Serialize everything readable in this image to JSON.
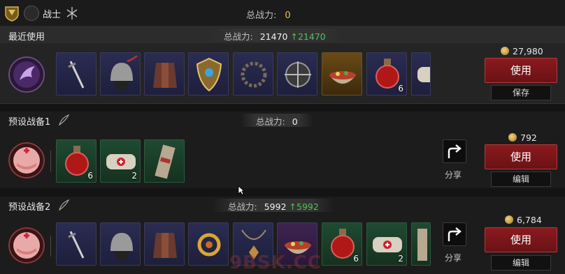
{
  "topbar": {
    "class_name": "战士",
    "power_label": "总战力:",
    "power_value": "0",
    "icons": [
      "rank-badge-icon",
      "class-crest-icon"
    ]
  },
  "recent": {
    "title": "最近使用",
    "power_label": "总战力:",
    "power_value": "21470",
    "power_gain": "↑21470",
    "price": "27,980",
    "use_label": "使用",
    "save_label": "保存",
    "items": [
      {
        "icon": "sword-icon",
        "count": ""
      },
      {
        "icon": "helmet-icon",
        "count": ""
      },
      {
        "icon": "armor-icon",
        "count": ""
      },
      {
        "icon": "shield-icon",
        "count": ""
      },
      {
        "icon": "thorn-ring-icon",
        "count": ""
      },
      {
        "icon": "compass-amulet-icon",
        "count": ""
      },
      {
        "icon": "food-bowl-icon",
        "count": ""
      },
      {
        "icon": "red-potion-icon",
        "count": "6"
      },
      {
        "icon": "bandage-icon",
        "count": ""
      }
    ]
  },
  "preset1": {
    "title": "预设战备1",
    "power_label": "总战力:",
    "power_value": "0",
    "price": "792",
    "use_label": "使用",
    "edit_label": "编辑",
    "share_label": "分享",
    "items": [
      {
        "icon": "red-potion-icon",
        "count": "6"
      },
      {
        "icon": "bandage-icon",
        "count": "2"
      },
      {
        "icon": "splint-icon",
        "count": ""
      }
    ]
  },
  "preset2": {
    "title": "预设战备2",
    "power_label": "总战力:",
    "power_value": "5992",
    "power_gain": "↑5992",
    "price": "6,784",
    "use_label": "使用",
    "edit_label": "编辑",
    "share_label": "分享",
    "items": [
      {
        "icon": "sword-icon",
        "count": ""
      },
      {
        "icon": "helmet-icon",
        "count": ""
      },
      {
        "icon": "armor-icon",
        "count": ""
      },
      {
        "icon": "gold-amulet-icon",
        "count": ""
      },
      {
        "icon": "gem-necklace-icon",
        "count": ""
      },
      {
        "icon": "food-bowl-icon",
        "count": ""
      },
      {
        "icon": "red-potion-icon",
        "count": "6"
      },
      {
        "icon": "bandage-icon",
        "count": "2"
      },
      {
        "icon": "splint-icon",
        "count": ""
      }
    ]
  },
  "watermark": "9BSK.CC",
  "colors": {
    "power_gain": "#4fc25a",
    "use_button": "#7a161a",
    "top_power": "#f0c040"
  }
}
